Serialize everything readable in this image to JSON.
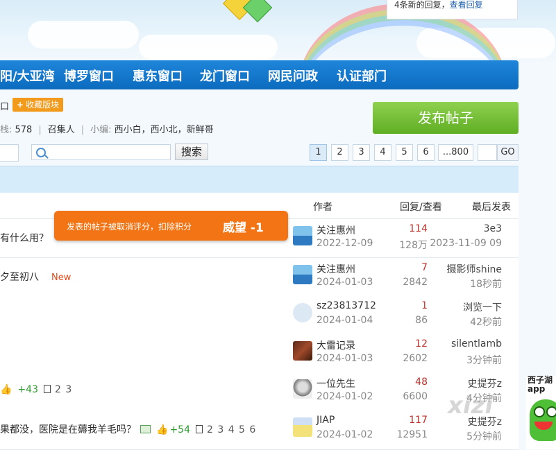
{
  "notice": {
    "text": "4条新的回复，",
    "link": "查看回复"
  },
  "nav": {
    "items": [
      "阳/大亚湾",
      "博罗窗口",
      "惠东窗口",
      "龙门窗口",
      "网民问政",
      "认证部门"
    ]
  },
  "board": {
    "frag": "口",
    "fav_label": "收藏版块",
    "stats_label": "栈: ",
    "stats_value": "578",
    "host": "召集人",
    "editors_label": "小编: ",
    "editors": "西小白，西小北，新鲜哥",
    "post_button": "发布帖子"
  },
  "search": {
    "placeholder": "",
    "button": "搜索"
  },
  "pagination": {
    "pages": [
      "1",
      "2",
      "3",
      "4",
      "5",
      "6",
      "...800"
    ],
    "current": "1",
    "goto_value": "",
    "go_label": "GO"
  },
  "columns": {
    "author": "作者",
    "reply_view": "回复/查看",
    "last_post": "最后发表"
  },
  "toast": {
    "message": "发表的帖子被取消评分，扣除积分",
    "value": "威望 -1"
  },
  "threads": [
    {
      "title": "有什么用？",
      "extra": "",
      "author": "关注惠州",
      "date": "2022-12-09",
      "replies": "114",
      "views": "128万",
      "last_user": "3e3",
      "last_time": "2023-11-09 09"
    },
    {
      "title": "夕至初八",
      "extra": "New",
      "author": "关注惠州",
      "date": "2024-01-03",
      "replies": "7",
      "views": "2842",
      "last_user": "摄影师shine",
      "last_time": "18秒前"
    },
    {
      "title": "",
      "extra": "",
      "author": "sz23813712",
      "date": "2024-01-04",
      "replies": "1",
      "views": "86",
      "last_user": "浏览一下",
      "last_time": "42秒前"
    },
    {
      "title": "",
      "extra": "",
      "author": "大雷记录",
      "date": "2024-01-03",
      "replies": "12",
      "views": "2602",
      "last_user": "silentlamb",
      "last_time": "3分钟前"
    },
    {
      "title": "",
      "likes": "+43",
      "pages": "2 3",
      "author": "一位先生",
      "date": "2024-01-02",
      "replies": "48",
      "views": "6600",
      "last_user": "史提芬z",
      "last_time": "4分钟前"
    },
    {
      "title": "果都没，医院是在薅我羊毛吗？",
      "likes": "+54",
      "pages": "2 3 4 5 6",
      "author": "JIAP",
      "date": "2024-01-02",
      "replies": "117",
      "views": "12951",
      "last_user": "史提芬z",
      "last_time": "5分钟前"
    }
  ],
  "watermark": "xizi",
  "promo": {
    "line1": "西子湖",
    "line2": "app"
  }
}
